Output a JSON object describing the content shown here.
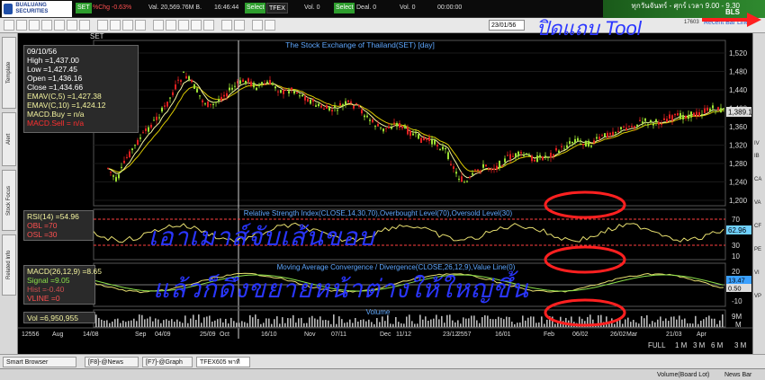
{
  "topbar": {
    "logo": "BUALUANG SECURITIES",
    "symbol": "SET",
    "change": "%Chg -0.63%",
    "value": "Val. 20,569.76M B.",
    "time": "16:46:44",
    "select1": "Select",
    "futures": "TFEX",
    "vol": "Vol. 0",
    "select2": "Select",
    "deal": "Deal. 0",
    "vol2": "Vol. 0",
    "price": "00:00:00",
    "promo_line1": "ทุกวันจันทร์ - ศุกร์ เวลา 9.00 - 9.30",
    "promo_line2": "BLS"
  },
  "toolbar": {
    "date": "23/01/56",
    "right_label": "Recent Bar Line",
    "zoom": "17603"
  },
  "left_tabs": [
    "Template",
    "Alert",
    "Stock Focus",
    "Related Info"
  ],
  "right_labels": [
    "IV",
    "IB",
    "CA",
    "VA",
    "CF",
    "PE",
    "VI",
    "VP"
  ],
  "chart": {
    "title": "The Stock Exchange of Thailand(SET) [day]",
    "symbol_box": "SET",
    "price_axis": [
      "1,520",
      "1,480",
      "1,440",
      "1,400",
      "1,360",
      "1,320",
      "1,280",
      "1,240",
      "1,200"
    ],
    "last_price": "1,389.1",
    "info": {
      "date": "09/10/56",
      "high": "High  =1,437.00",
      "low": "Low  =1,427.45",
      "open": "Open  =1,436.16",
      "close": "Close  =1,434.66",
      "ema5": "EMAV(C,5)  =1,427.38",
      "ema10": "EMAV(C,10)  =1,424.12",
      "macd_buy": "MACD.Buy  = n/a",
      "macd_sell": "MACD.Sell  = n/a"
    }
  },
  "rsi": {
    "title": "Relative Strength Index(CLOSE,14,30,70),Overbought Level(70),Oversold Level(30)",
    "value": "RSI(14)   =54.96",
    "obl": "OBL   =70",
    "osl": "OSL   =30",
    "axis": [
      "70",
      "30",
      "10"
    ],
    "last": "62.96"
  },
  "macd": {
    "title": "Moving Average Convergence / Divergence(CLOSE,26,12,9),Value Line(0)",
    "macd": "MACD(26,12,9)  =8.65",
    "signal": "Signal   =9.05",
    "hist": "Hist   =-0.40",
    "vline": "VLINE   =0",
    "axis": [
      "20",
      "0",
      "-10"
    ],
    "last1": "13.47",
    "last2": "0.50"
  },
  "volume": {
    "title": "Volume",
    "value": "Vol   =6,950,955",
    "axis": [
      "9M",
      "M"
    ]
  },
  "time_axis": [
    "12556",
    "Aug",
    "14/08",
    "Sep",
    "04/09",
    "25/09",
    "Oct",
    "16/10",
    "Nov",
    "07/11",
    "Dec",
    "11/12",
    "23/12",
    "2557",
    "16/01",
    "Feb",
    "06/02",
    "26/02",
    "Mar",
    "21/03",
    "Apr"
  ],
  "bottom_tools": {
    "full": "FULL",
    "m1": "1 M",
    "m3": "3 M",
    "m6": "6 M",
    "m3b": "3 M"
  },
  "taskbar": [
    "Smart Browser",
    "[F8]-@News",
    "[F7]-@Graph",
    "TFEX605 พาที"
  ],
  "statusbar": {
    "left": "",
    "vol_board": "Volume(Board Lot)",
    "news_bar": "News Bar"
  },
  "annotations": {
    "close_tool": "ปิดแถบ Tool",
    "line1": "เอาเมาส์จับเส้นขอบ",
    "line2": "แล้วก็ดึงขยายหน้าต่างให้ใหญ่ขึ้น"
  },
  "colors": {
    "candle_up": "#9be033",
    "candle_down": "#e02020",
    "ema5": "#f5f5a0",
    "ema10": "#d9c800",
    "accent_red": "#ff2020",
    "annotation_blue": "#2a36ff"
  }
}
